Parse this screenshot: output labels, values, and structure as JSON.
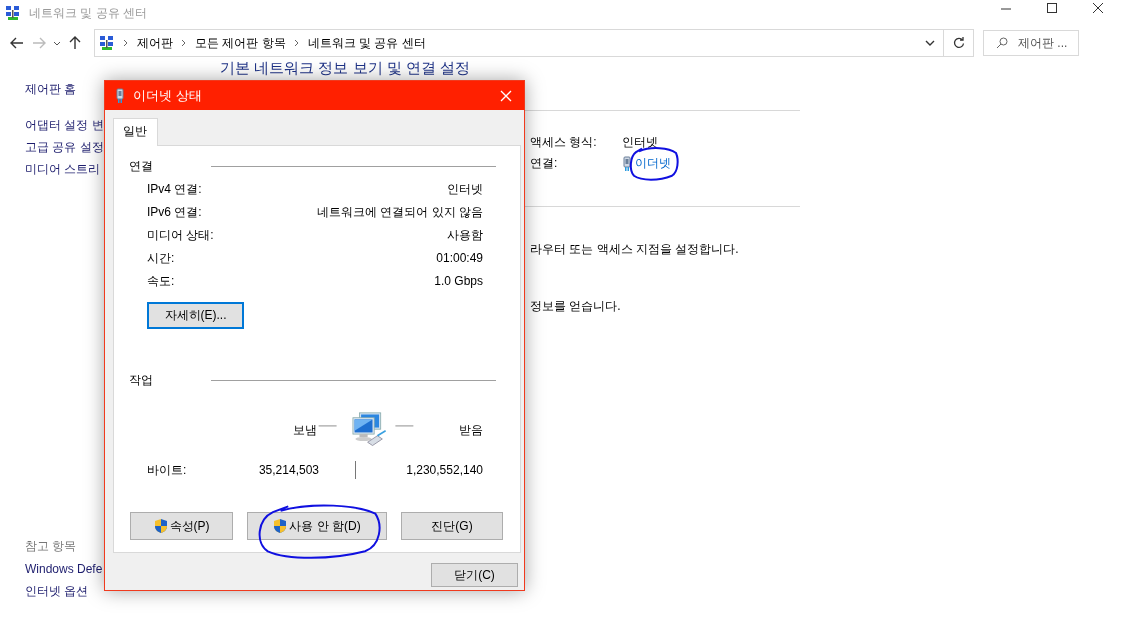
{
  "window": {
    "title": "네트워크 및 공유 센터"
  },
  "address_bar": {
    "breadcrumb": [
      "제어판",
      "모든 제어판 항목",
      "네트워크 및 공유 센터"
    ]
  },
  "search": {
    "placeholder": "제어판 ..."
  },
  "sidebar": {
    "items": [
      "제어판 홈",
      "어댑터 설정 변",
      "고급 공유 설정",
      "미디어 스트리"
    ],
    "see_also_title": "참고 항목",
    "see_also": [
      "Windows Defe",
      "인터넷 옵션"
    ]
  },
  "main": {
    "heading": "기본 네트워크 정보 보기 및 연결 설정",
    "access_rows": [
      {
        "label": "액세스 형식:",
        "value": "인터넷",
        "kind": "text",
        "highlight": false
      },
      {
        "label": "연결:",
        "value": "이더넷",
        "kind": "link",
        "highlight": true
      }
    ],
    "lines": [
      "라우터 또는 액세스 지점을 설정합니다.",
      "정보를 얻습니다."
    ]
  },
  "dialog": {
    "title": "이더넷 상태",
    "tabs": [
      {
        "label": "일반",
        "selected": true
      }
    ],
    "connection": {
      "title": "연결",
      "rows": [
        {
          "label": "IPv4 연결:",
          "value": "인터넷"
        },
        {
          "label": "IPv6 연결:",
          "value": "네트워크에 연결되어 있지 않음"
        },
        {
          "label": "미디어 상태:",
          "value": "사용함"
        },
        {
          "label": "시간:",
          "value": "01:00:49"
        },
        {
          "label": "속도:",
          "value": "1.0 Gbps"
        }
      ],
      "details_button": {
        "label": "자세히(E)...",
        "focused": true
      }
    },
    "activity": {
      "title": "작업",
      "sent_label": "보냄",
      "received_label": "받음",
      "bytes_label": "바이트:",
      "sent": "35,214,503",
      "received": "1,230,552,140"
    },
    "buttons": [
      {
        "label": "속성(P)",
        "shield": true,
        "highlight": false
      },
      {
        "label": "사용 안 함(D)",
        "shield": true,
        "highlight": true
      },
      {
        "label": "진단(G)",
        "shield": false,
        "highlight": false
      }
    ],
    "close_button": "닫기(C)"
  }
}
